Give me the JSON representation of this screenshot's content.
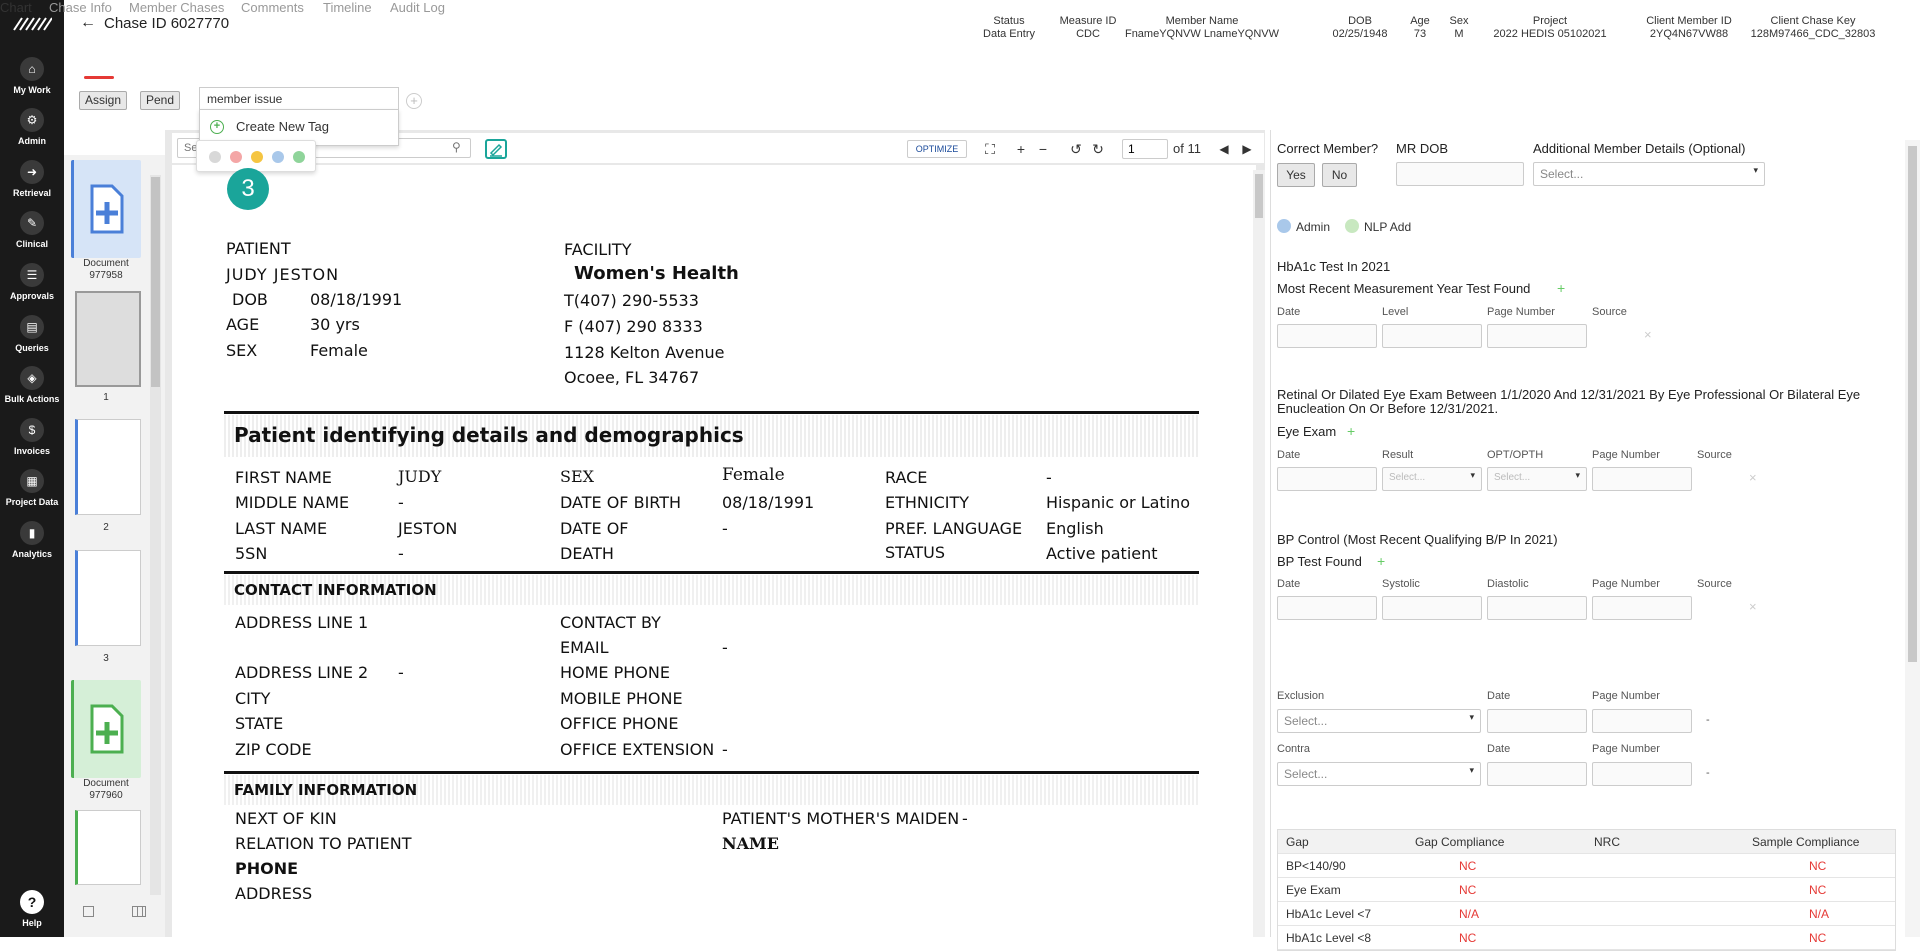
{
  "sidebar": {
    "items": [
      {
        "label": "My Work",
        "icon": "home-icon",
        "glyph": "⌂"
      },
      {
        "label": "Admin",
        "icon": "gear-icon",
        "glyph": "⚙"
      },
      {
        "label": "Retrieval",
        "icon": "retrieval-icon",
        "glyph": "➜"
      },
      {
        "label": "Clinical",
        "icon": "clinical-icon",
        "glyph": "✎"
      },
      {
        "label": "Approvals",
        "icon": "approvals-icon",
        "glyph": "☰"
      },
      {
        "label": "Queries",
        "icon": "queries-icon",
        "glyph": "▤"
      },
      {
        "label": "Bulk Actions",
        "icon": "layers-icon",
        "glyph": "◈"
      },
      {
        "label": "Invoices",
        "icon": "invoices-icon",
        "glyph": "$"
      },
      {
        "label": "Project Data",
        "icon": "project-data-icon",
        "glyph": "▦"
      },
      {
        "label": "Analytics",
        "icon": "analytics-icon",
        "glyph": "▮"
      }
    ],
    "help": "Help"
  },
  "header": {
    "chase_title": "Chase ID 6027770",
    "meta": [
      {
        "label": "Status",
        "value": "Data Entry"
      },
      {
        "label": "Measure ID",
        "value": "CDC"
      },
      {
        "label": "Member Name",
        "value": "FnameYQNVW LnameYQNVW"
      },
      {
        "label": "DOB",
        "value": "02/25/1948"
      },
      {
        "label": "Age",
        "value": "73"
      },
      {
        "label": "Sex",
        "value": "M"
      },
      {
        "label": "Project",
        "value": "2022 HEDIS 05102021"
      },
      {
        "label": "Client Member ID",
        "value": "2YQ4N67VW88"
      },
      {
        "label": "Client Chase Key",
        "value": "128M97466_CDC_32803"
      }
    ]
  },
  "tabs": [
    "Chart",
    "Chase Info",
    "Member Chases",
    "Comments",
    "Timeline",
    "Audit Log"
  ],
  "actions": {
    "assign": "Assign",
    "pend": "Pend"
  },
  "tag": {
    "input_value": "member issue",
    "create_label": "Create New Tag",
    "badge": "3",
    "colors": [
      "#d8d8d8",
      "#f4a6a6",
      "#f5c542",
      "#a9c8ea",
      "#8fd49a"
    ]
  },
  "thumbs": [
    {
      "label": "Document",
      "sub": "977958",
      "color": "#4a7fd8",
      "bg": "#d6e4f7"
    },
    {
      "label": "1"
    },
    {
      "label": "2"
    },
    {
      "label": "3"
    },
    {
      "label": "Document",
      "sub": "977960",
      "color": "#4caf50",
      "bg": "#d5efd7"
    }
  ],
  "viewer": {
    "search_placeholder": "Se",
    "optimize": "OPTIMIZE",
    "page": "1",
    "of": "of 11"
  },
  "doc": {
    "patient_lbl": "PATIENT",
    "patient_name": "JUDY  JESTON",
    "dob_lbl": "DOB",
    "dob": "08/18/1991",
    "age_lbl": "AGE",
    "age": "30 yrs",
    "sex_lbl": "SEX",
    "sex": "Female",
    "facility_lbl": "FACILITY",
    "facility": "Women's Health",
    "phone": "T(407) 290-5533",
    "fax": "F   (407) 290 8333",
    "addr1": "1128 Kelton Avenue",
    "addr2": "Ocoee, FL 34767",
    "demo_hdr": "Patient identifying details and demographics",
    "first_name_lbl": "FIRST NAME",
    "first_name": "JUDY",
    "middle_lbl": "MIDDLE NAME",
    "middle": "-",
    "last_lbl": "LAST NAME",
    "last": "JESTON",
    "ssn_lbl": "5SN",
    "ssn": "-",
    "sex2_lbl": "SEX",
    "sex2": "Female",
    "dob2_lbl": "DATE OF BIRTH",
    "dob2": "08/18/1991",
    "dod_lbl": "DATE OF",
    "dod_lbl2": "DEATH",
    "dod": "-",
    "race_lbl": "RACE",
    "race": "-",
    "eth_lbl": "ETHNICITY",
    "eth": "Hispanic or Latino",
    "lang_lbl": "PREF. LANGUAGE",
    "lang": "English",
    "status_lbl": "STATUS",
    "status": "Active patient",
    "contact_hdr": "CONTACT INFORMATION",
    "addr_l1": "ADDRESS LINE 1",
    "addr_l2": "ADDRESS LINE 2",
    "addr_l2_val": "-",
    "city": "CITY",
    "state": "STATE",
    "zip": "ZIP CODE",
    "contact_by": "CONTACT BY",
    "email": "EMAIL",
    "email_val": "-",
    "home": "HOME PHONE",
    "mobile": "MOBILE PHONE",
    "office": "OFFICE PHONE",
    "office_ext": "OFFICE EXTENSION",
    "office_ext_val": "-",
    "family_hdr": "FAMILY INFORMATION",
    "kin": "NEXT OF KIN",
    "relation": "RELATION TO PATIENT",
    "phone2": "PHONE",
    "address": "ADDRESS",
    "maiden": "PATIENT'S MOTHER'S MAIDEN",
    "maiden2": "NAME",
    "maiden_val": "-"
  },
  "panel": {
    "correct_member": "Correct Member?",
    "yes": "Yes",
    "no": "No",
    "mr_dob": "MR DOB",
    "additional": "Additional Member Details (Optional)",
    "select": "Select...",
    "legend_admin": "Admin",
    "legend_nlp": "NLP Add",
    "hba1c_title": "HbA1c Test In 2021",
    "hba1c_sub": "Most Recent Measurement Year Test Found",
    "date": "Date",
    "level": "Level",
    "page_number": "Page Number",
    "source": "Source",
    "eye_title": "Retinal Or Dilated Eye Exam Between 1/1/2020 And 12/31/2021 By Eye Professional Or Bilateral Eye Enucleation On Or Before 12/31/2021.",
    "eye_sub": "Eye Exam",
    "result": "Result",
    "opt": "OPT/OPTH",
    "bp_title": "BP Control (Most Recent Qualifying B/P In 2021)",
    "bp_sub": "BP Test Found",
    "systolic": "Systolic",
    "diastolic": "Diastolic",
    "exclusion": "Exclusion",
    "contra": "Contra",
    "dash": "-"
  },
  "gap_table": {
    "headers": [
      "Gap",
      "Gap Compliance",
      "NRC",
      "Sample Compliance"
    ],
    "rows": [
      [
        "BP<140/90",
        "NC",
        "",
        "NC"
      ],
      [
        "Eye Exam",
        "NC",
        "",
        "NC"
      ],
      [
        "HbA1c Level <7",
        "N/A",
        "",
        "N/A"
      ],
      [
        "HbA1c Level <8",
        "NC",
        "",
        "NC"
      ]
    ]
  }
}
